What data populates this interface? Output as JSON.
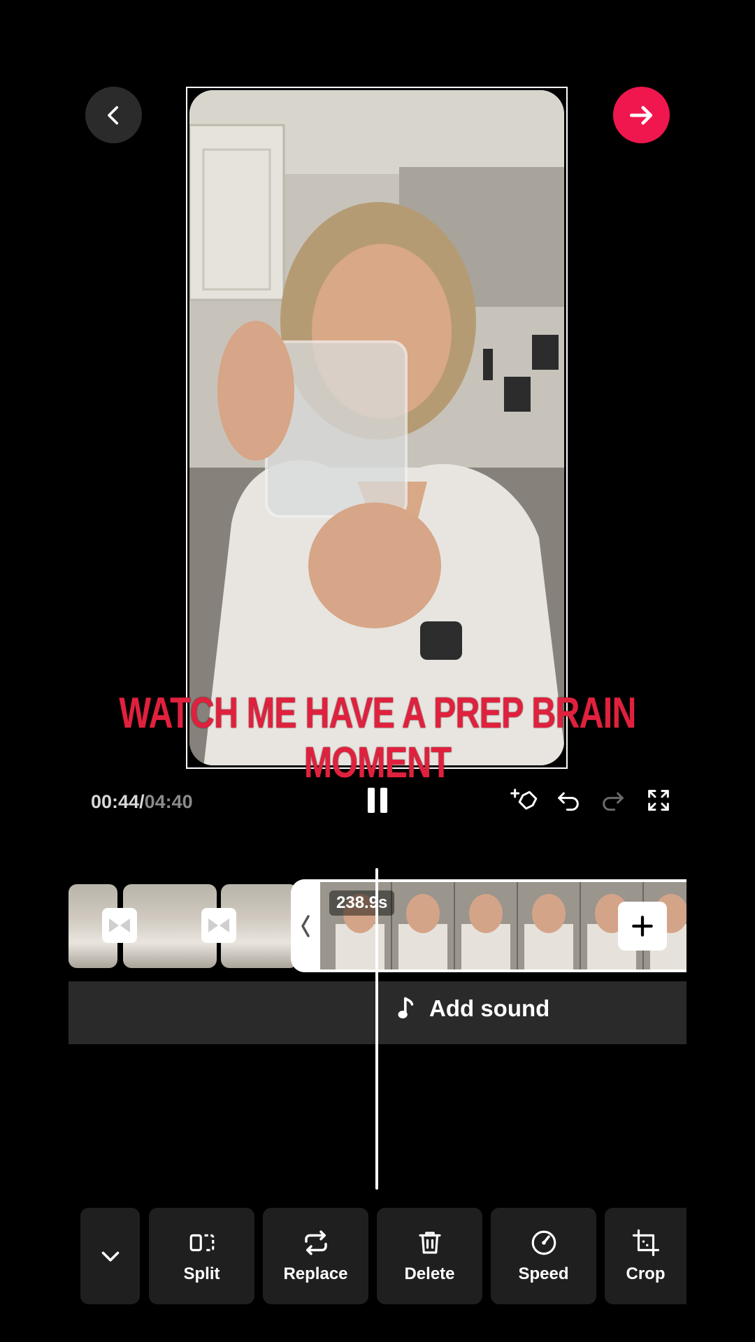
{
  "caption": "WATCH ME HAVE A PREP BRAIN MOMENT",
  "playback": {
    "current_time": "00:44",
    "separator": "/",
    "total_time": "04:40"
  },
  "timeline": {
    "selected_clip_duration": "238.9s"
  },
  "sound": {
    "add_label": "Add sound"
  },
  "toolbar": {
    "items": [
      {
        "label": "Split",
        "icon": "split-icon"
      },
      {
        "label": "Replace",
        "icon": "replace-icon"
      },
      {
        "label": "Delete",
        "icon": "trash-icon"
      },
      {
        "label": "Speed",
        "icon": "speed-icon"
      },
      {
        "label": "Crop",
        "icon": "crop-icon"
      }
    ]
  },
  "colors": {
    "accent": "#f0164e",
    "caption": "#e0213e"
  }
}
